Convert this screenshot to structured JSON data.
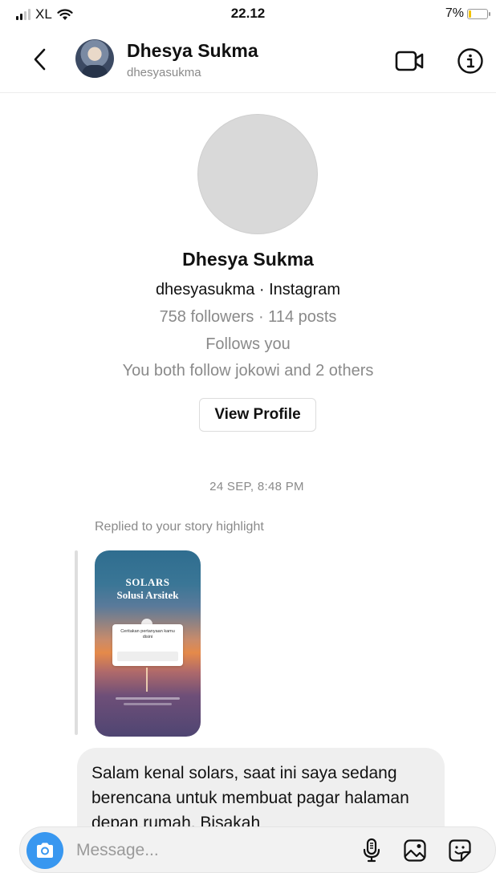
{
  "status_bar": {
    "carrier": "XL",
    "time": "22.12",
    "battery": "7%",
    "battery_level": 0.07
  },
  "header": {
    "name": "Dhesya Sukma",
    "username": "dhesyasukma",
    "icons": [
      "back-icon",
      "video-call-icon",
      "info-icon"
    ]
  },
  "profile": {
    "name": "Dhesya Sukma",
    "source_line": "dhesyasukma · Instagram",
    "stats": "758 followers · 114 posts",
    "follows_you": "Follows you",
    "mutuals": "You both follow jokowi and 2 others",
    "view_profile_label": "View Profile"
  },
  "thread": {
    "timestamp": "24 SEP, 8:48 PM",
    "replied_label": "Replied to your story highlight",
    "story": {
      "title_line1": "SOLARS",
      "title_line2": "Solusi Arsitek",
      "card_text": "Ceritakan pertanyaan kamu disini"
    },
    "message_text": "Salam kenal solars,  saat ini saya sedang berencana untuk membuat pagar halaman depan rumah. Bisakah"
  },
  "composer": {
    "placeholder": "Message...",
    "icons": [
      "camera-icon",
      "microphone-icon",
      "gallery-icon",
      "sticker-icon"
    ],
    "accent_color": "#3897f0"
  }
}
